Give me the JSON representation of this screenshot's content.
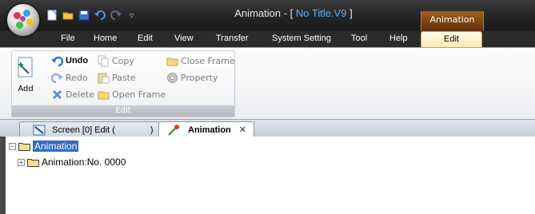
{
  "window": {
    "title_app": "Animation - [",
    "title_doc": " No Title.V9 ",
    "title_end": "]"
  },
  "context_tab": {
    "label": "Animation"
  },
  "ribbon_tabs": [
    {
      "label": "File"
    },
    {
      "label": "Home"
    },
    {
      "label": "Edit"
    },
    {
      "label": "View"
    },
    {
      "label": "Transfer"
    },
    {
      "label": "System Setting"
    },
    {
      "label": "Tool"
    },
    {
      "label": "Help"
    },
    {
      "label": "Edit",
      "active": true
    }
  ],
  "ribbon": {
    "group_label": "Edit",
    "add_label": "Add",
    "buttons": {
      "undo": "Undo",
      "redo": "Redo",
      "delete": "Delete",
      "copy": "Copy",
      "paste": "Paste",
      "open_frame": "Open Frame",
      "close_frame": "Close Frame",
      "property": "Property"
    }
  },
  "doc_tabs": {
    "screen": "Screen [0] Edit (",
    "screen_end": ")",
    "animation": "Animation",
    "close_glyph": "✕"
  },
  "tree": {
    "root": "Animation",
    "child": "Animation:No. 0000",
    "root_expander": "−",
    "child_expander": "+"
  },
  "colors": {
    "accent_doc_title": "#5ab0ff",
    "selection": "#316ac5",
    "context_tab": "#a35e1c"
  }
}
